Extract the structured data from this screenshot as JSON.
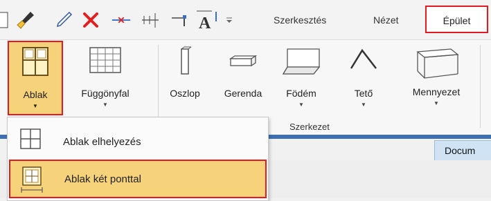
{
  "toolbar": {
    "tabs": [
      {
        "label": "Szerkesztés"
      },
      {
        "label": "Nézet"
      },
      {
        "label": "Épület"
      }
    ]
  },
  "ribbon": {
    "buttons": [
      {
        "label": "Ablak"
      },
      {
        "label": "Függönyfal"
      },
      {
        "label": "Oszlop"
      },
      {
        "label": "Gerenda"
      },
      {
        "label": "Födém"
      },
      {
        "label": "Tető"
      },
      {
        "label": "Mennyezet"
      }
    ],
    "group_label": "Szerkezet"
  },
  "dropdown": {
    "items": [
      {
        "label": "Ablak elhelyezés"
      },
      {
        "label": "Ablak két ponttal"
      }
    ]
  },
  "document": {
    "tab_label": "Docum"
  },
  "colors": {
    "highlight": "#f6d27a",
    "outline": "#e21a22",
    "doc_strip": "#3e6fb3"
  }
}
